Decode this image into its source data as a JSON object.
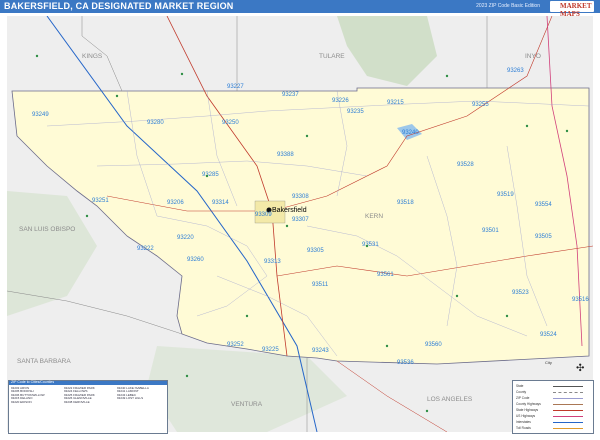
{
  "header": {
    "title": "BAKERSFIELD, CA DESIGNATED MARKET REGION",
    "edition": "2023 ZIP Code Basic Edition",
    "logo": "MARKET MAPS"
  },
  "counties": [
    "KINGS",
    "TULARE",
    "INYO",
    "KERN",
    "SAN LUIS OBISPO",
    "SANTA BARBARA",
    "VENTURA",
    "LOS ANGELES"
  ],
  "city_label": "Bakersfield",
  "zip_labels": [
    "93227",
    "93237",
    "93215",
    "93226",
    "93249",
    "93280",
    "93250",
    "93235",
    "93240",
    "93255",
    "93388",
    "93285",
    "93308",
    "93263",
    "93528",
    "93251",
    "93206",
    "93314",
    "93309",
    "93307",
    "93518",
    "93519",
    "93554",
    "93222",
    "93220",
    "93313",
    "93305",
    "93531",
    "93501",
    "93505",
    "93260",
    "93561",
    "93523",
    "93511",
    "93243",
    "93516",
    "93252",
    "93225",
    "93524",
    "93560",
    "93536"
  ],
  "colors": {
    "title_bar": "#3b78c4",
    "region_fill": "#fffbd6",
    "zip_label": "#2e7fd6",
    "water": "#9cc7ea",
    "land_outside": "#eeeeee",
    "hills": "#c4d8b9"
  },
  "legend_left": {
    "title": "ZIP Code to Cities/Counties",
    "rows": [
      "93203 ARVIN",
      "93205 BODFISH",
      "93206 BUTTONWILLOW",
      "93215 DELANO",
      "93220 EDISON",
      "93222 FRAZIER PARK",
      "93224 FELLOWS",
      "93225 FRAZIER PARK",
      "93226 GLENNVILLE",
      "93238 KERNVILLE",
      "93240 LAKE ISABELLA",
      "93241 LAMONT",
      "93243 LEBEC",
      "93249 LOST HILLS"
    ]
  },
  "legend_right": {
    "rows": [
      "State",
      "County",
      "ZIP Code",
      "County Highways",
      "State Highways",
      "US Highways",
      "Interstates",
      "Toll Roads"
    ]
  },
  "scale_label": "City"
}
